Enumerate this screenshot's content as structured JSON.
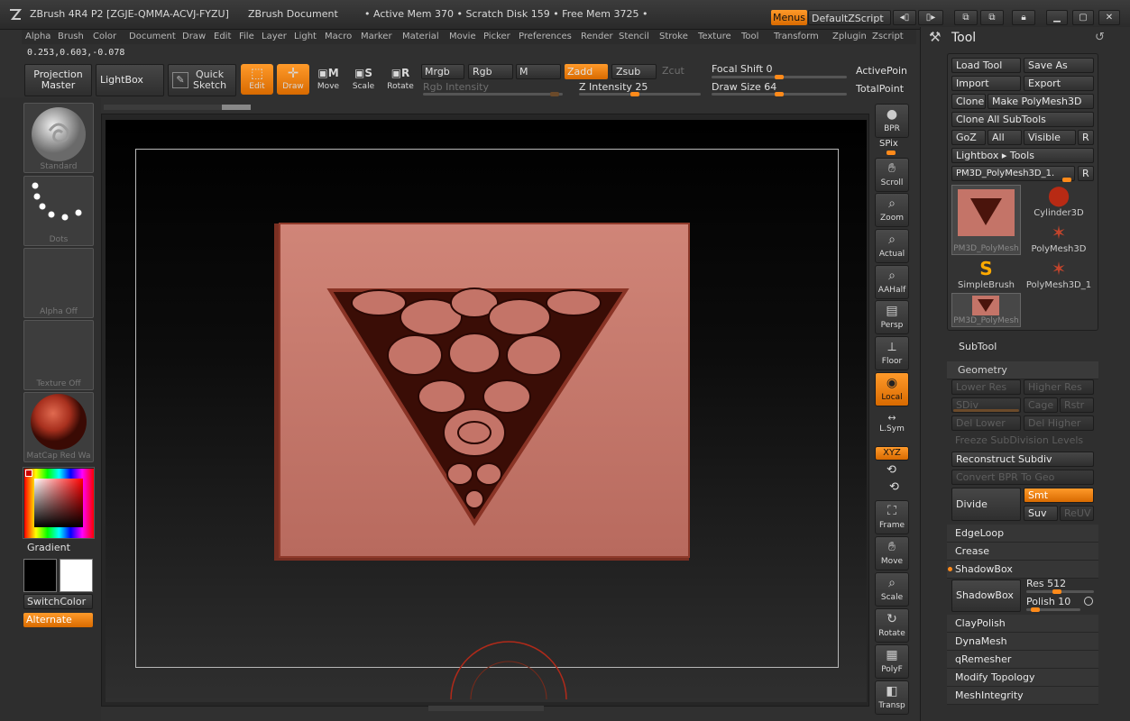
{
  "title_bar": {
    "app": "ZBrush 4R4 P2 [ZGJE-QMMA-ACVJ-FYZU]",
    "document": "ZBrush Document",
    "memory": "• Active Mem 370 • Scratch Disk 159 • Free Mem 3725 •",
    "menus_label": "Menus",
    "script_label": "DefaultZScript"
  },
  "menu_bar": [
    "Alpha",
    "Brush",
    "Color",
    "Document",
    "Draw",
    "Edit",
    "File",
    "Layer",
    "Light",
    "Macro",
    "Marker",
    "Material",
    "Movie",
    "Picker",
    "Preferences",
    "Render",
    "Stencil",
    "Stroke",
    "Texture",
    "Tool",
    "Transform",
    "Zplugin",
    "Zscript"
  ],
  "coords": "0.253,0.603,-0.078",
  "shelf": {
    "projection_master": "Projection\nMaster",
    "lightbox": "LightBox",
    "quick_sketch": "Quick\nSketch",
    "edit": "Edit",
    "draw": "Draw",
    "move": "Move",
    "scale": "Scale",
    "rotate": "Rotate",
    "mrgb": "Mrgb",
    "rgb": "Rgb",
    "m": "M",
    "zadd": "Zadd",
    "zsub": "Zsub",
    "zcut": "Zcut",
    "rgb_intensity": "Rgb Intensity",
    "z_intensity": "Z Intensity 25",
    "focal_shift": "Focal Shift 0",
    "draw_size": "Draw Size 64",
    "active_points": "ActivePoin",
    "total_points": "TotalPoint"
  },
  "left_panel": {
    "brush": "Standard",
    "stroke": "Dots",
    "alpha": "Alpha Off",
    "texture": "Texture Off",
    "material": "MatCap Red Wa",
    "gradient": "Gradient",
    "switch_color": "SwitchColor",
    "alternate": "Alternate"
  },
  "right_shelf": [
    {
      "label": "BPR",
      "icon": "bpr-sphere-icon"
    },
    {
      "label": "SPix",
      "icon": "spix-slider-icon"
    },
    {
      "label": "Scroll",
      "icon": "scroll-hand-icon"
    },
    {
      "label": "Zoom",
      "icon": "zoom-magnifier-icon"
    },
    {
      "label": "Actual",
      "icon": "actual-magnifier-icon"
    },
    {
      "label": "AAHalf",
      "icon": "aahalf-magnifier-icon"
    },
    {
      "label": "Persp",
      "icon": "perspective-grid-icon"
    },
    {
      "label": "Floor",
      "icon": "floor-icon"
    },
    {
      "label": "Local",
      "icon": "local-pivot-icon"
    },
    {
      "label": "L.Sym",
      "icon": "local-symmetry-icon"
    },
    {
      "label": "XYZ",
      "icon": "xyz-axis-icon"
    },
    {
      "label": "Frame",
      "icon": "frame-icon"
    },
    {
      "label": "Move",
      "icon": "move-hand-icon"
    },
    {
      "label": "Scale",
      "icon": "scale-magnifier-icon"
    },
    {
      "label": "Rotate",
      "icon": "rotate-icon"
    },
    {
      "label": "PolyF",
      "icon": "polyframe-grid-icon"
    },
    {
      "label": "Transp",
      "icon": "transparency-icon"
    }
  ],
  "tool_panel": {
    "title": "Tool",
    "load_tool": "Load Tool",
    "save_as": "Save As",
    "import": "Import",
    "export": "Export",
    "clone": "Clone",
    "make_polymesh": "Make PolyMesh3D",
    "clone_all": "Clone All SubTools",
    "goz": "GoZ",
    "all": "All",
    "visible": "Visible",
    "r": "R",
    "lightbox_tools": "Lightbox ▸ Tools",
    "current_tool": "PM3D_PolyMesh3D_1.",
    "tools": [
      {
        "name": "PM3D_PolyMesh",
        "icon": "pm3d-thumbnail-icon"
      },
      {
        "name": "Cylinder3D",
        "icon": "cylinder-icon"
      },
      {
        "name": "PolyMesh3D",
        "icon": "polymesh-star-icon"
      },
      {
        "name": "SimpleBrush",
        "icon": "simplebrush-icon"
      },
      {
        "name": "PolyMesh3D_1",
        "icon": "polymesh-star-icon"
      },
      {
        "name": "PM3D_PolyMesh",
        "icon": "pm3d-thumbnail-icon"
      }
    ],
    "subtool": "SubTool",
    "geometry": "Geometry",
    "lower_res": "Lower Res",
    "higher_res": "Higher Res",
    "sdiv": "SDiv",
    "cage": "Cage",
    "rstr": "Rstr",
    "del_lower": "Del Lower",
    "del_higher": "Del Higher",
    "freeze": "Freeze SubDivision Levels",
    "reconstruct": "Reconstruct Subdiv",
    "convert_bpr": "Convert BPR To Geo",
    "divide": "Divide",
    "smt": "Smt",
    "suv": "Suv",
    "reuv": "ReUV",
    "edgeloop": "EdgeLoop",
    "crease": "Crease",
    "shadowbox_header": "ShadowBox",
    "shadowbox_btn": "ShadowBox",
    "res": "Res 512",
    "polish": "Polish 10",
    "claypolish": "ClayPolish",
    "dynamesh": "DynaMesh",
    "qremesher": "qRemesher",
    "modify_topology": "Modify Topology",
    "mesh_integrity": "MeshIntegrity"
  },
  "colors": {
    "accent": "#ff8a1a",
    "clay": "#c47468",
    "background": "#303030"
  }
}
